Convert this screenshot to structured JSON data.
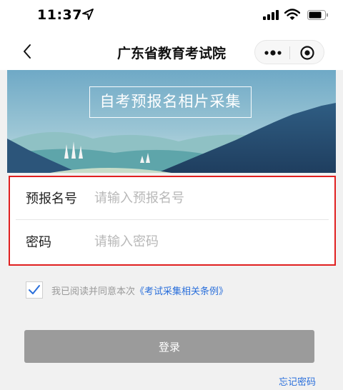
{
  "status_bar": {
    "time": "11:37"
  },
  "nav": {
    "title": "广东省教育考试院"
  },
  "banner": {
    "title": "自考预报名相片采集"
  },
  "form": {
    "fields": [
      {
        "label": "预报名号",
        "placeholder": "请输入预报名号",
        "value": ""
      },
      {
        "label": "密码",
        "placeholder": "请输入密码",
        "value": ""
      }
    ]
  },
  "agreement": {
    "checked": true,
    "text": "我已阅读并同意本次",
    "link": "《考试采集相关条例》"
  },
  "login_button": {
    "label": "登录"
  },
  "forgot_password": {
    "label": "忘记密码"
  },
  "colors": {
    "highlight": "#e02020",
    "link": "#2a6fdb",
    "button": "#9b9b9b"
  }
}
